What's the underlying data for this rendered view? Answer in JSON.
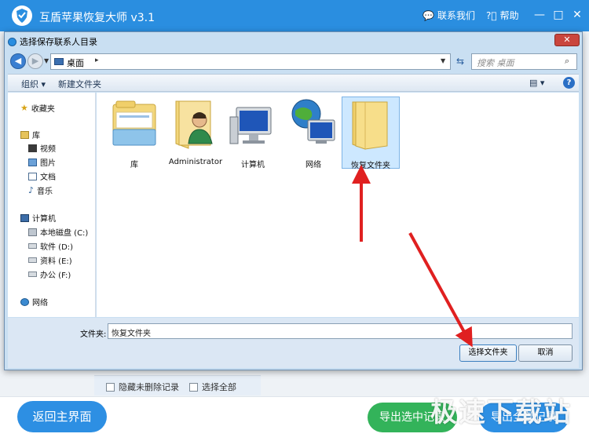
{
  "app": {
    "title": "互盾苹果恢复大师 v3.1",
    "contact": "联系我们",
    "help": "帮助"
  },
  "dialog": {
    "title": "选择保存联系人目录",
    "address": "桌面",
    "search_placeholder": "搜索 桌面",
    "toolbar": {
      "organize": "组织 ▾",
      "new_folder": "新建文件夹"
    },
    "nav": {
      "favorites": "收藏夹",
      "libraries": "库",
      "videos": "视频",
      "pictures": "图片",
      "documents": "文档",
      "music": "音乐",
      "computer": "计算机",
      "drive_c": "本地磁盘 (C:)",
      "drive_d": "软件 (D:)",
      "drive_e": "资料 (E:)",
      "drive_f": "办公 (F:)",
      "network": "网络"
    },
    "items": [
      {
        "label": "库",
        "icon": "library-icon"
      },
      {
        "label": "Administrator",
        "icon": "user-folder-icon"
      },
      {
        "label": "计算机",
        "icon": "computer-icon"
      },
      {
        "label": "网络",
        "icon": "network-icon"
      },
      {
        "label": "恢复文件夹",
        "icon": "folder-icon",
        "selected": true
      }
    ],
    "filename_label": "文件夹:",
    "filename_value": "恢复文件夹",
    "choose_button": "选择文件夹",
    "cancel_button": "取消"
  },
  "behind": {
    "hide_deleted": "隐藏未删除记录",
    "select_all": "选择全部"
  },
  "bottom": {
    "home_button": "返回主界面",
    "export_selected": "导出选中记录",
    "export_all": "导出全部记录"
  },
  "watermark": "极速下载站"
}
